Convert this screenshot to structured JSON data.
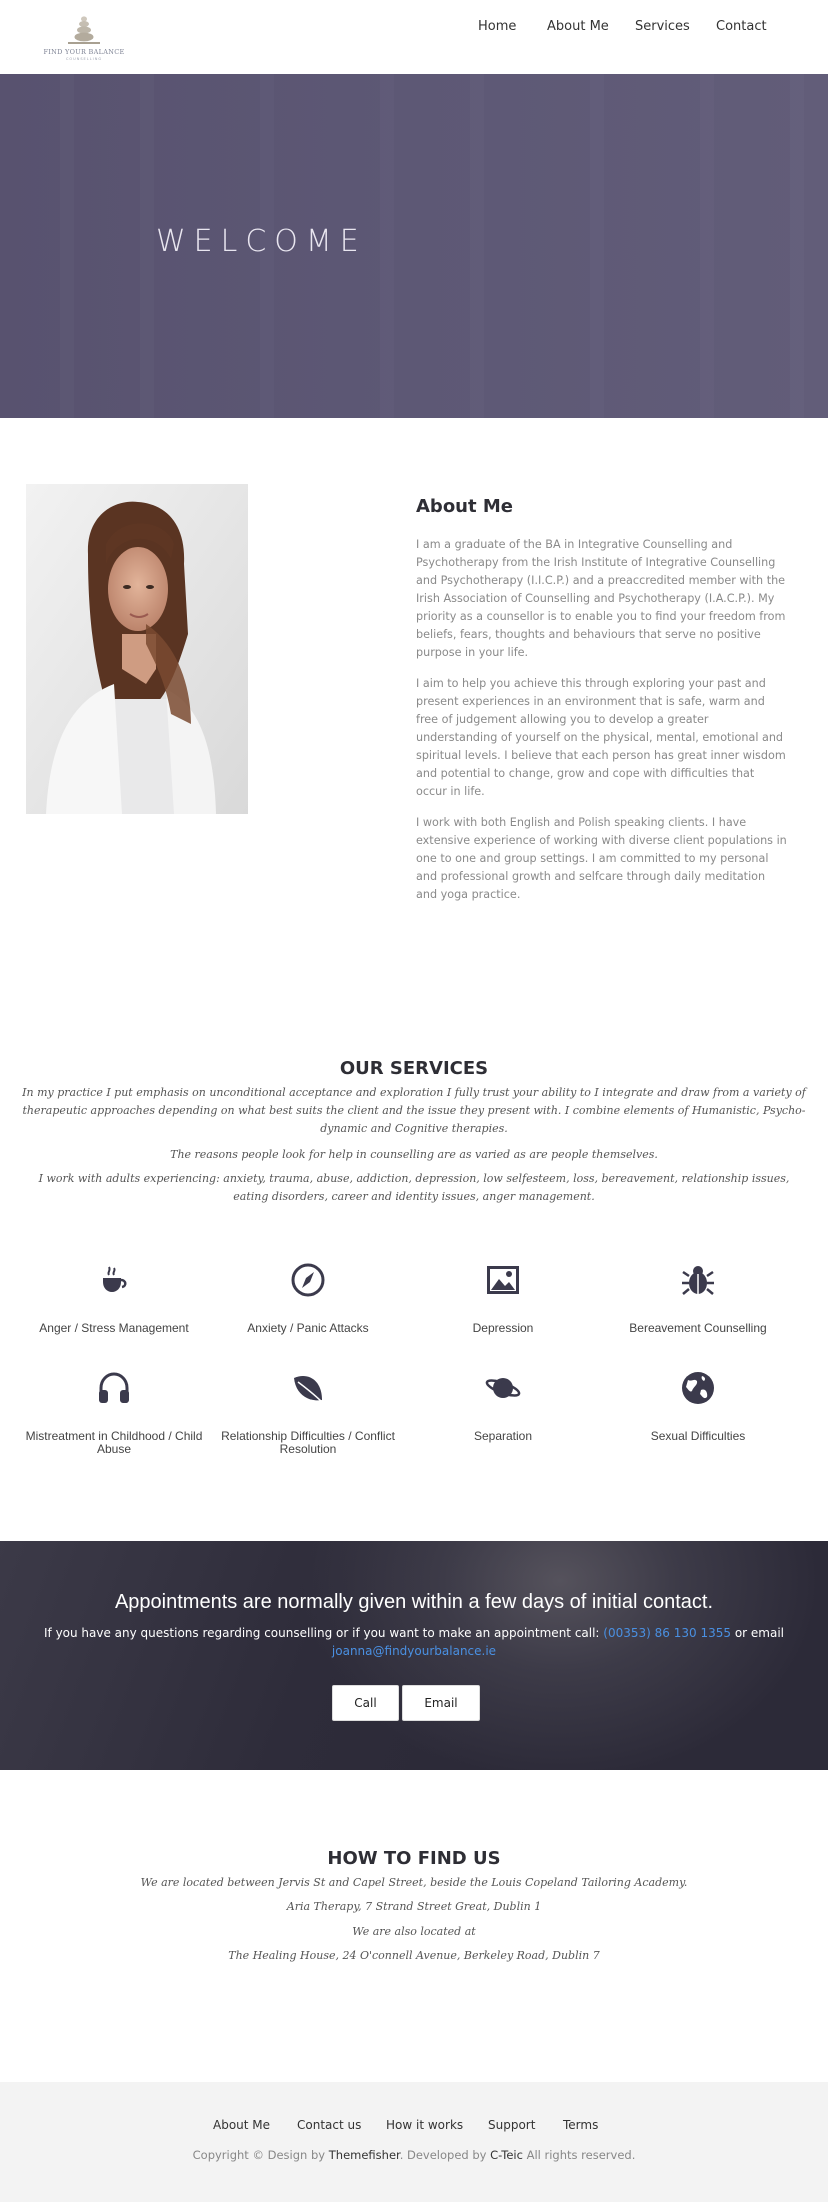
{
  "header": {
    "logo_text": "FIND YOUR BALANCE",
    "logo_sub": "COUNSELLING",
    "nav": [
      "Home",
      "About Me",
      "Services",
      "Contact"
    ]
  },
  "hero": {
    "title": "WELCOME"
  },
  "about": {
    "title": "About Me",
    "paragraphs": [
      "I am a graduate of the BA in Integrative Counselling and Psychotherapy from the Irish Institute of Integrative Counselling and Psychotherapy (I.I.C.P.) and a preaccredited member with the Irish Association of Counselling and Psychotherapy (I.A.C.P.). My priority as a counsellor is to enable you to find your freedom from beliefs, fears, thoughts and behaviours that serve no positive purpose in your life.",
      "I aim to help you achieve this through exploring your past and present experiences in an environment that is safe, warm and free of judgement  allowing you to develop a greater understanding of yourself on the physical, mental, emotional and spiritual levels. I believe that each person has great inner wisdom and potential to change, grow and cope with difficulties that occur in life.",
      "I work with both English and Polish speaking clients. I have extensive experience of working with diverse client populations in one to one and group settings. I am committed to my personal and professional growth and selfcare through daily meditation and yoga practice."
    ]
  },
  "services": {
    "title": "OUR SERVICES",
    "intro": "In my practice I put emphasis on unconditional acceptance and exploration I fully trust your ability to I integrate and draw from a variety of therapeutic approaches depending on what best suits the client and the issue they present with. I combine elements of Humanistic, Psycho-dynamic and Cognitive therapies.",
    "reasons": "The reasons people look for help in counselling are as varied as are people themselves.",
    "adults": "I work with adults experiencing: anxiety, trauma, abuse, addiction, depression, low selfesteem, loss, bereavement, relationship issues, eating disorders, career and identity issues, anger management.",
    "items": [
      {
        "label": "Anger / Stress Management",
        "icon": "coffee-icon"
      },
      {
        "label": "Anxiety / Panic Attacks",
        "icon": "compass-icon"
      },
      {
        "label": "Depression",
        "icon": "image-icon"
      },
      {
        "label": "Bereavement Counselling",
        "icon": "bug-icon"
      },
      {
        "label": "Mistreatment in Childhood / Child Abuse",
        "icon": "headphones-icon"
      },
      {
        "label": "Relationship Difficulties / Conflict Resolution",
        "icon": "leaf-icon"
      },
      {
        "label": "Separation",
        "icon": "planet-icon"
      },
      {
        "label": "Sexual Difficulties",
        "icon": "globe-icon"
      }
    ]
  },
  "appointments": {
    "title": "Appointments are normally given within a few days of initial contact.",
    "text_before": "If you have any questions regarding counselling or if you want to make an appointment call: ",
    "phone": "(00353) 86 130 1355",
    "text_mid": " or email ",
    "email": "joanna@findyourbalance.ie",
    "call_label": "Call",
    "email_label": "Email"
  },
  "find_us": {
    "title": "HOW TO FIND US",
    "lines": [
      "We are located between Jervis St and Capel Street, beside the Louis Copeland Tailoring Academy.",
      "Aria Therapy, 7 Strand Street Great, Dublin 1",
      "We are also located at",
      "The Healing House, 24 O'connell Avenue, Berkeley Road, Dublin 7"
    ]
  },
  "footer": {
    "links": [
      "About Me",
      "Contact us",
      "How it works",
      "Support",
      "Terms"
    ],
    "copy_prefix": "Copyright © Design by ",
    "designer": "Themefisher",
    "copy_mid": ". Developed by ",
    "developer": "C-Teic",
    "copy_suffix": " All rights reserved."
  },
  "colors": {
    "hero": "#5d5875",
    "icon": "#3b3a4c",
    "link": "#4a90e2",
    "appointment_band": "#2c2a38"
  }
}
